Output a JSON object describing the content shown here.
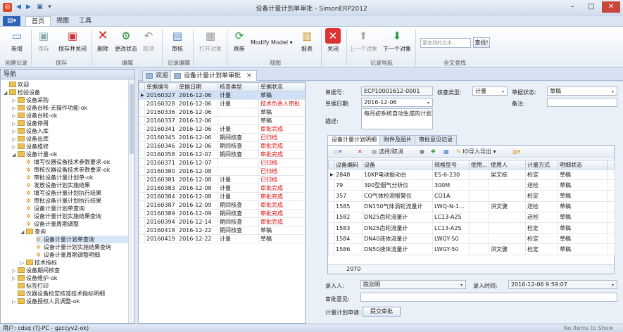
{
  "window": {
    "title": "设备计量计划单审批 - SimonERP2012"
  },
  "ribbon_tabs": [
    "首页",
    "视图",
    "工具"
  ],
  "ribbon": {
    "buttons": {
      "new": "新增",
      "save": "保存",
      "save_close": "保存并关闭",
      "delete": "删除",
      "change_status": "更改状态",
      "cancel": "取消",
      "review": "审核",
      "open_object": "打开对象",
      "refresh": "刷新",
      "modify_model": "Modify Model",
      "report": "报表",
      "close": "关闭",
      "prev_object": "上一个对象",
      "next_object": "下一个对象"
    },
    "groups": {
      "create": "创建记录",
      "save": "保存",
      "edit": "编辑",
      "record_edit": "记录编辑",
      "view": "视图",
      "record_nav": "记录导航",
      "fulltext": "全文查找"
    },
    "search_placeholder": "要查找的文本...",
    "search_button": "查找!"
  },
  "nav": {
    "title": "导航",
    "items": [
      "欢迎",
      "检验设备",
      "设备采购",
      "设备台帐-无操作功能-ok",
      "设备台帐-ok",
      "设备停用",
      "设备入库",
      "设备出库",
      "设备维修",
      "设备计量-ok",
      "填写仪器设备技术参数要求-ok",
      "审核仪器设备技术参数要求-ok",
      "审批设备计量计划单-ok",
      "发放设备计划实施结果",
      "填写设备计量计划执行结果",
      "审批设备计量计划执行结果",
      "设备计量计划单查询",
      "设备计量计划实施结果查询",
      "设备计量周期调整",
      "查询",
      "设备计量计划单查询",
      "设备计量计划实施结果查询",
      "设备计量周期调整明细",
      "技术指标",
      "设备期间核查",
      "设备维护-ok",
      "标签打印",
      "仪器设备检定核准技术指标明细",
      "设备授权人员调整-ok"
    ]
  },
  "doc_tabs": [
    "欢迎",
    "设备计量计划单审批"
  ],
  "main_grid": {
    "columns": [
      "单据编号",
      "单据日期",
      "核查类型",
      "单据状态"
    ],
    "rows": [
      [
        "20160327",
        "2016-12-06",
        "计量",
        "草稿"
      ],
      [
        "20160328",
        "2016-12-06",
        "计量",
        "技术负责人审批"
      ],
      [
        "20160336",
        "2016-12-06",
        "",
        "草稿"
      ],
      [
        "20160337",
        "2016-12-06",
        "",
        "草稿"
      ],
      [
        "20160341",
        "2016-12-06",
        "计量",
        "审批完成"
      ],
      [
        "20160345",
        "2016-12-06",
        "期间核查",
        "已归档"
      ],
      [
        "20160346",
        "2016-12-06",
        "期间核查",
        "审批完成"
      ],
      [
        "20160358",
        "2016-12-07",
        "期间核查",
        "审批完成"
      ],
      [
        "20160371",
        "2016-12-07",
        "",
        "已归档"
      ],
      [
        "20160380",
        "2016-12-08",
        "",
        "已归档"
      ],
      [
        "20160381",
        "2016-12-08",
        "计量",
        "已归档"
      ],
      [
        "20160383",
        "2016-12-08",
        "计量",
        "审批完成"
      ],
      [
        "20160384",
        "2016-12-08",
        "计量",
        "审批完成"
      ],
      [
        "20160387",
        "2016-12-09",
        "期间核查",
        "审批完成"
      ],
      [
        "20160389",
        "2016-12-09",
        "期间核查",
        "审批完成"
      ],
      [
        "20160394",
        "2016-12-14",
        "期间核查",
        "审批完成"
      ],
      [
        "20160418",
        "2016-12-22",
        "期间核查",
        "草稿"
      ],
      [
        "20160419",
        "2016-12-22",
        "计量",
        "草稿"
      ]
    ],
    "red_statuses": [
      "技术负责人审批",
      "审批完成",
      "已归档"
    ]
  },
  "detail": {
    "doc_no_label": "单据号:",
    "doc_no": "ECP10001612-0001",
    "check_type_label": "核查类型:",
    "check_type": "计量",
    "doc_status_label": "单据状态:",
    "doc_status": "草稿",
    "doc_date_label": "单据日期:",
    "doc_date": "2016-12-06",
    "remark_label": "备注:",
    "desc_label": "描述:",
    "desc": "每月初系统自动生成的计划",
    "entry_label": "录入人:",
    "entry_person": "陈剑明",
    "entry_time_label": "录入时间:",
    "entry_time": "2016-12-06 9:59:07",
    "approval_label": "审批意见:",
    "apply_label": "计量计划申请:",
    "submit_button": "提交审批"
  },
  "sub_tabs": [
    "设备计量计划明细",
    "附件及图片",
    "审批意见记录"
  ],
  "sub_toolbar": {
    "select_cancel": "选择/取消",
    "io": "IO导入导出"
  },
  "sub_grid": {
    "columns": [
      "设备编码",
      "设备",
      "规格型号",
      "使用...",
      "使用人",
      "计量方式",
      "明细状态"
    ],
    "rows": [
      [
        "2848",
        "10KP电动振动台",
        "ES-6-230",
        "",
        "吴文栋",
        "检定",
        "草稿"
      ],
      [
        "79",
        "300型烟气分析仪",
        "300M",
        "",
        "",
        "送检",
        "草稿"
      ],
      [
        "357",
        "CO气体检测报警仪",
        "CO1A",
        "",
        "",
        "检定",
        "草稿"
      ],
      [
        "1585",
        "DN150气体涡轮流量计",
        "LWQ-N-1...",
        "",
        "洪文健",
        "送检",
        "草稿"
      ],
      [
        "1582",
        "DN25齿轮流量计",
        "LC13-A2S",
        "",
        "",
        "送检",
        "草稿"
      ],
      [
        "1583",
        "DN25齿轮流量计",
        "LC13-A2S",
        "",
        "",
        "检定",
        "草稿"
      ],
      [
        "1584",
        "DN40液体流量计",
        "LWGY-50",
        "",
        "",
        "检定",
        "草稿"
      ],
      [
        "1586",
        "DN50液体流量计",
        "LWGY-50",
        "",
        "洪文健",
        "检定",
        "草稿"
      ]
    ],
    "footer_count": "2070"
  },
  "status": {
    "user": "用户: cdsq (TJ-PC - gzccyv2-ok)",
    "right": "No Items to Show"
  }
}
